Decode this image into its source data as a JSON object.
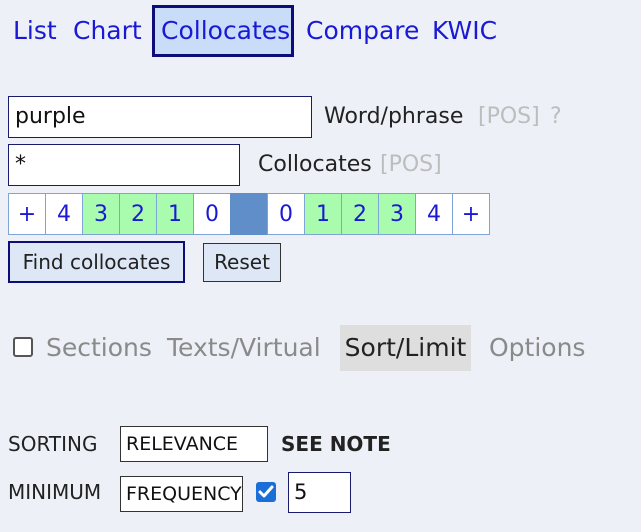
{
  "tabs": [
    {
      "label": "List"
    },
    {
      "label": "Chart"
    },
    {
      "label": "Collocates"
    },
    {
      "label": "Compare"
    },
    {
      "label": "KWIC"
    }
  ],
  "search": {
    "word_value": "purple",
    "word_label": "Word/phrase",
    "word_pos": "[POS]",
    "word_help": "?",
    "colloc_value": "*",
    "colloc_label": "Collocates",
    "colloc_pos": "[POS]"
  },
  "positions": {
    "left": [
      "+",
      "4",
      "3",
      "2",
      "1",
      "0"
    ],
    "right": [
      "0",
      "1",
      "2",
      "3",
      "4",
      "+"
    ]
  },
  "buttons": {
    "find": "Find collocates",
    "reset": "Reset"
  },
  "subtabs": {
    "sections": "Sections",
    "texts": "Texts/Virtual",
    "sort": "Sort/Limit",
    "options": "Options"
  },
  "sorting": {
    "label": "SORTING",
    "value": "RELEVANCE",
    "note": "SEE NOTE"
  },
  "minimum": {
    "label": "MINIMUM",
    "value": "FREQUENCY",
    "number": "5"
  },
  "colors": {
    "link": "#1a1ad6",
    "selected_cell": "#a9fbae",
    "node_cell": "#5f8ec8",
    "background": "#edf1f7"
  }
}
